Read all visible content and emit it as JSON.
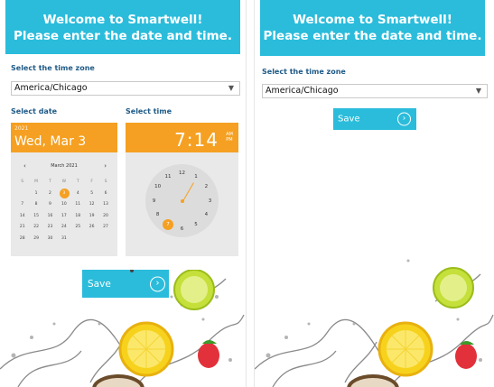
{
  "left_screen": {
    "header": {
      "line1": "Welcome to Smartwell!",
      "line2": "Please enter the date and time."
    },
    "timezone": {
      "label": "Select the time zone",
      "value": "America/Chicago",
      "arrow": "▼"
    },
    "date": {
      "label": "Select date",
      "year": "2021",
      "display": "Wed, Mar 3",
      "month_title": "March 2021",
      "prev": "‹",
      "next": "›",
      "weekdays": [
        "S",
        "M",
        "T",
        "W",
        "T",
        "F",
        "S"
      ],
      "weeks": [
        [
          "",
          "1",
          "2",
          "3",
          "4",
          "5",
          "6"
        ],
        [
          "7",
          "8",
          "9",
          "10",
          "11",
          "12",
          "13"
        ],
        [
          "14",
          "15",
          "16",
          "17",
          "18",
          "19",
          "20"
        ],
        [
          "21",
          "22",
          "23",
          "24",
          "25",
          "26",
          "27"
        ],
        [
          "28",
          "29",
          "30",
          "31",
          "",
          "",
          ""
        ]
      ],
      "selected_day": "3"
    },
    "time": {
      "label": "Select time",
      "display": "7:14",
      "am": "AM",
      "pm": "PM",
      "selected_hour": "7",
      "numbers": [
        "12",
        "1",
        "2",
        "3",
        "4",
        "5",
        "6",
        "7",
        "8",
        "9",
        "10",
        "11"
      ]
    },
    "save": {
      "label": "Save",
      "icon": "arrow-circle-right-icon",
      "glyph": "›"
    }
  },
  "right_screen": {
    "header": {
      "line1": "Welcome to Smartwell!",
      "line2": "Please enter the date and time."
    },
    "timezone": {
      "label": "Select the time zone",
      "value": "America/Chicago",
      "arrow": "▼"
    },
    "save": {
      "label": "Save",
      "icon": "arrow-circle-right-icon",
      "glyph": "›"
    }
  },
  "colors": {
    "header": "#2bbcdb",
    "accent": "#f5a022",
    "label": "#1f5a86"
  }
}
